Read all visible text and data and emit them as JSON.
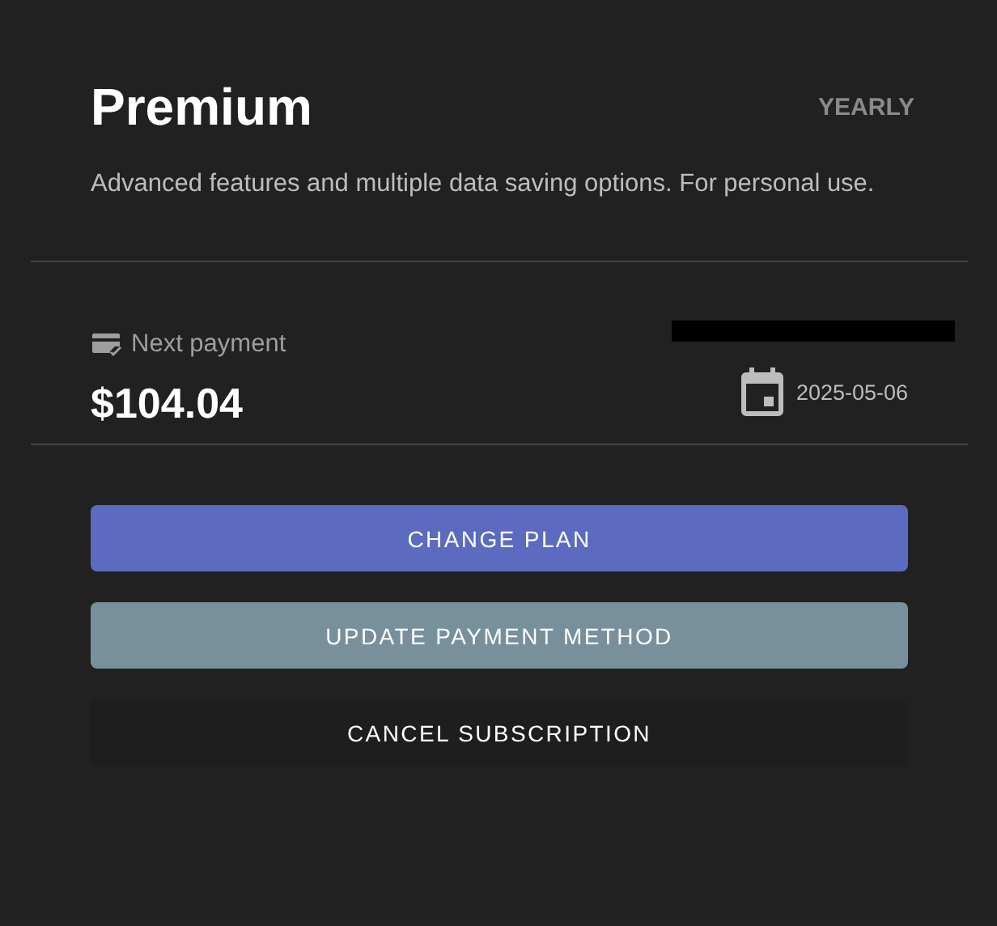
{
  "plan": {
    "name": "Premium",
    "period": "YEARLY",
    "description": "Advanced features and multiple data saving options. For personal use."
  },
  "payment": {
    "label": "Next payment",
    "amount": "$104.04",
    "date": "2025-05-06"
  },
  "buttons": [
    {
      "label": "CHANGE PLAN",
      "kind": "primary"
    },
    {
      "label": "UPDATE PAYMENT METHOD",
      "kind": "secondary"
    },
    {
      "label": "CANCEL SUBSCRIPTION",
      "kind": "text"
    }
  ]
}
